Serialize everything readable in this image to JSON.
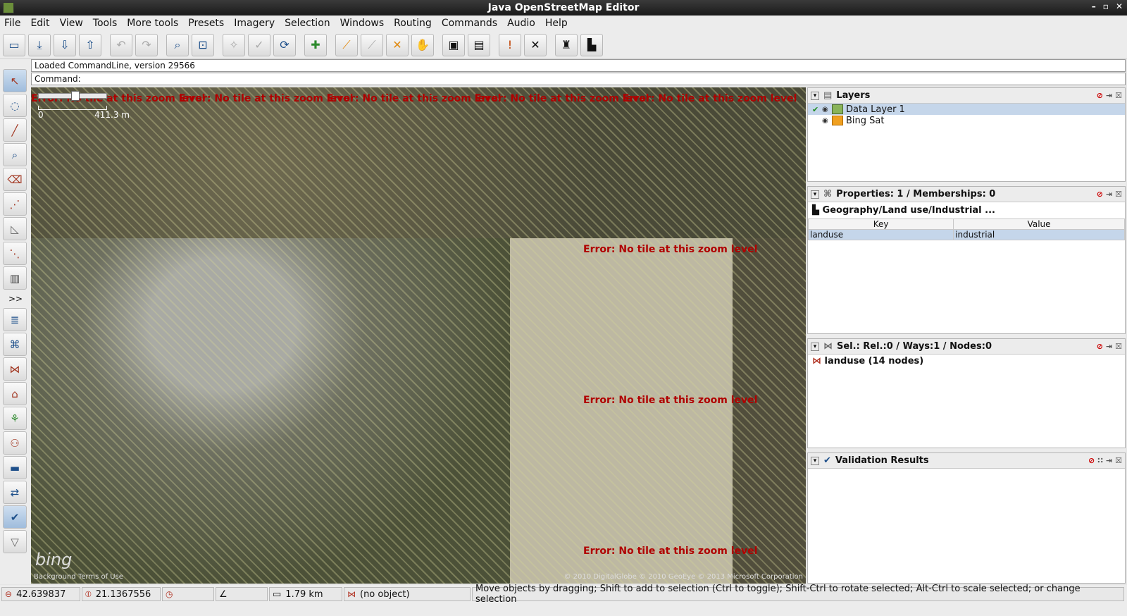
{
  "window": {
    "title": "Java OpenStreetMap Editor"
  },
  "menu": [
    "File",
    "Edit",
    "View",
    "Tools",
    "More tools",
    "Presets",
    "Imagery",
    "Selection",
    "Windows",
    "Routing",
    "Commands",
    "Audio",
    "Help"
  ],
  "toolbar_icons": [
    "open-icon",
    "save-icon",
    "download-icon",
    "upload-icon",
    "undo-icon",
    "redo-icon",
    "preferences-icon",
    "zoom-icon",
    "wireframe-icon",
    "select-icon",
    "refresh-icon",
    "fullscreen-icon",
    "split-way-icon",
    "combine-icon",
    "join-icon",
    "hand-icon",
    "car-icon",
    "bus-icon",
    "validator-icon",
    "close-icon",
    "castle-icon",
    "factory-icon"
  ],
  "command": {
    "log": "Loaded CommandLine, version 29566",
    "prompt": "Command:"
  },
  "map": {
    "scale_min": "0",
    "scale_max": "411.3 m",
    "error_text": "Error: No tile at this zoom level",
    "bing": "bing",
    "terms": "Background Terms of Use",
    "copyright": "© 2010 DigitalGlobe © 2010 GeoEye © 2013 Microsoft Corporation"
  },
  "layers": {
    "title": "Layers",
    "items": [
      {
        "name": "Data Layer 1",
        "selected": true
      },
      {
        "name": "Bing Sat",
        "selected": false
      }
    ]
  },
  "properties": {
    "title": "Properties: 1 / Memberships: 0",
    "preset": "Geography/Land use/Industrial ...",
    "col_key": "Key",
    "col_value": "Value",
    "rows": [
      {
        "key": "landuse",
        "value": "industrial"
      }
    ]
  },
  "selection": {
    "title": "Sel.: Rel.:0 / Ways:1 / Nodes:0",
    "item": "landuse (14 nodes)"
  },
  "validation": {
    "title": "Validation Results"
  },
  "status": {
    "lat": "42.639837",
    "lon": "21.1367556",
    "distance": "1.79 km",
    "object": "(no object)",
    "help": "Move objects by dragging; Shift to add to selection (Ctrl to toggle); Shift-Ctrl to rotate selected; Alt-Ctrl to scale selected; or change selection"
  },
  "colors": {
    "accent": "#c5d6ea",
    "error": "#b00000"
  }
}
